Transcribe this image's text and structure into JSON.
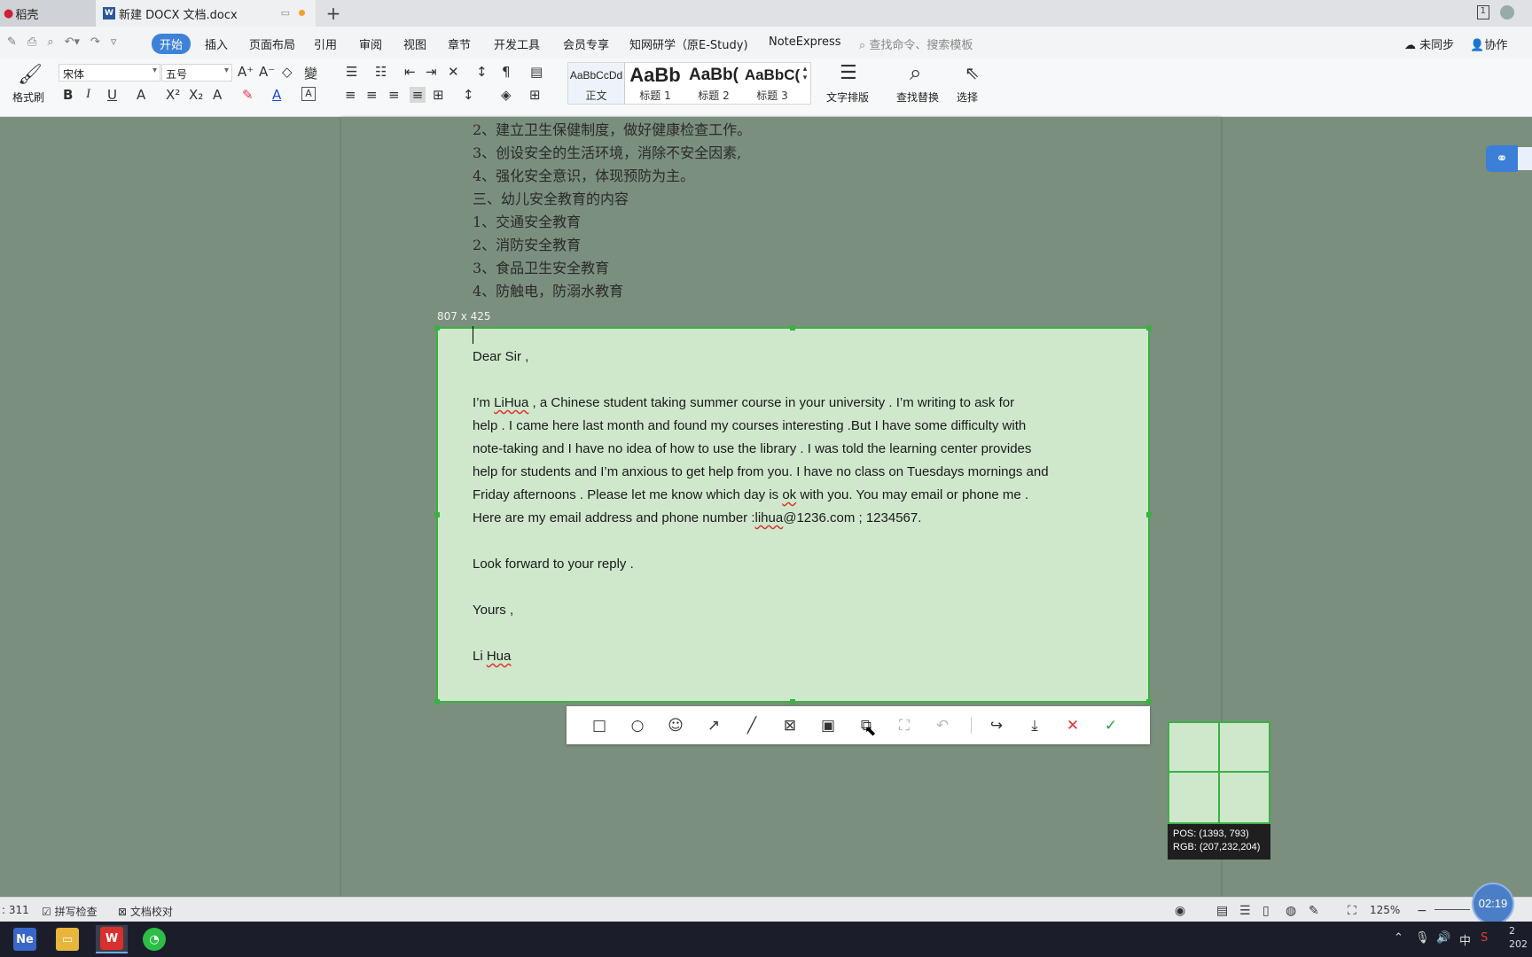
{
  "titlebar": {
    "tab1": "稻壳",
    "tab2": "新建 DOCX 文档.docx",
    "docicon": "W",
    "new_tab": "+",
    "window_badge": "1"
  },
  "menu": {
    "start": "开始",
    "items": [
      "插入",
      "页面布局",
      "引用",
      "审阅",
      "视图",
      "章节",
      "开发工具",
      "会员专享",
      "知网研学（原E-Study)",
      "NoteExpress"
    ],
    "search": "查找命令、搜索模板",
    "sync": "未同步",
    "collab": "协作"
  },
  "ribbon": {
    "format_painter": "格式刷",
    "font_name": "宋体",
    "font_size": "五号",
    "styles": [
      {
        "preview": "AaBbCcDd",
        "label": "正文"
      },
      {
        "preview": "AaBb",
        "label": "标题 1"
      },
      {
        "preview": "AaBb(",
        "label": "标题 2"
      },
      {
        "preview": "AaBbC(",
        "label": "标题 3"
      }
    ],
    "text_layout": "文字排版",
    "find_replace": "查找替换",
    "select": "选择"
  },
  "document": {
    "chinese_lines": [
      "2、建立卫生保健制度，做好健康检查工作。",
      "3、创设安全的生活环境，消除不安全因素,",
      "4、强化安全意识，体现预防为主。",
      "三、幼儿安全教育的内容",
      "1、交通安全教育",
      "2、消防安全教育",
      "3、食品卫生安全教育",
      "4、防触电，防溺水教育"
    ],
    "salutation": "Dear Sir ,",
    "body": {
      "l1a": "I’m ",
      "l1b": "LiHua",
      "l1c": " , a Chinese student taking summer course in your university . I’m writing to ask for",
      "l2": "help . I came here last month and found my courses interesting .But I have some difficulty with",
      "l3": "note-taking and I have no idea of how to use the library . I was told the learning center provides",
      "l4": "help for students and I’m anxious to get help from you. I have no class on Tuesdays mornings and",
      "l5a": "Friday afternoons . Please let me know which day is ",
      "l5b": "ok",
      "l5c": " with you. You may email or phone me .",
      "l6a": "Here are my email address and phone number :",
      "l6b": "lihua",
      "l6c": "@1236.com ; 1234567."
    },
    "closing": "Look forward to your reply .",
    "signoff": "Yours ,",
    "signature_a": "Li ",
    "signature_b": "Hua"
  },
  "capture": {
    "size": "807 x 425",
    "pos": "POS:  (1393, 793)",
    "rgb": "RGB:  (207,232,204)"
  },
  "status": {
    "page_count": ": 311",
    "spell_check": "拼写检查",
    "doc_proof": "文档校对",
    "zoom": "125%"
  },
  "timer": "02:19",
  "taskbar": {
    "ime": "中",
    "clock_top": "2",
    "clock_bottom": "202"
  },
  "colors": {
    "selection_border": "#3cb043",
    "selection_fill": "#cfe8cc",
    "accent": "#3d82d8"
  }
}
